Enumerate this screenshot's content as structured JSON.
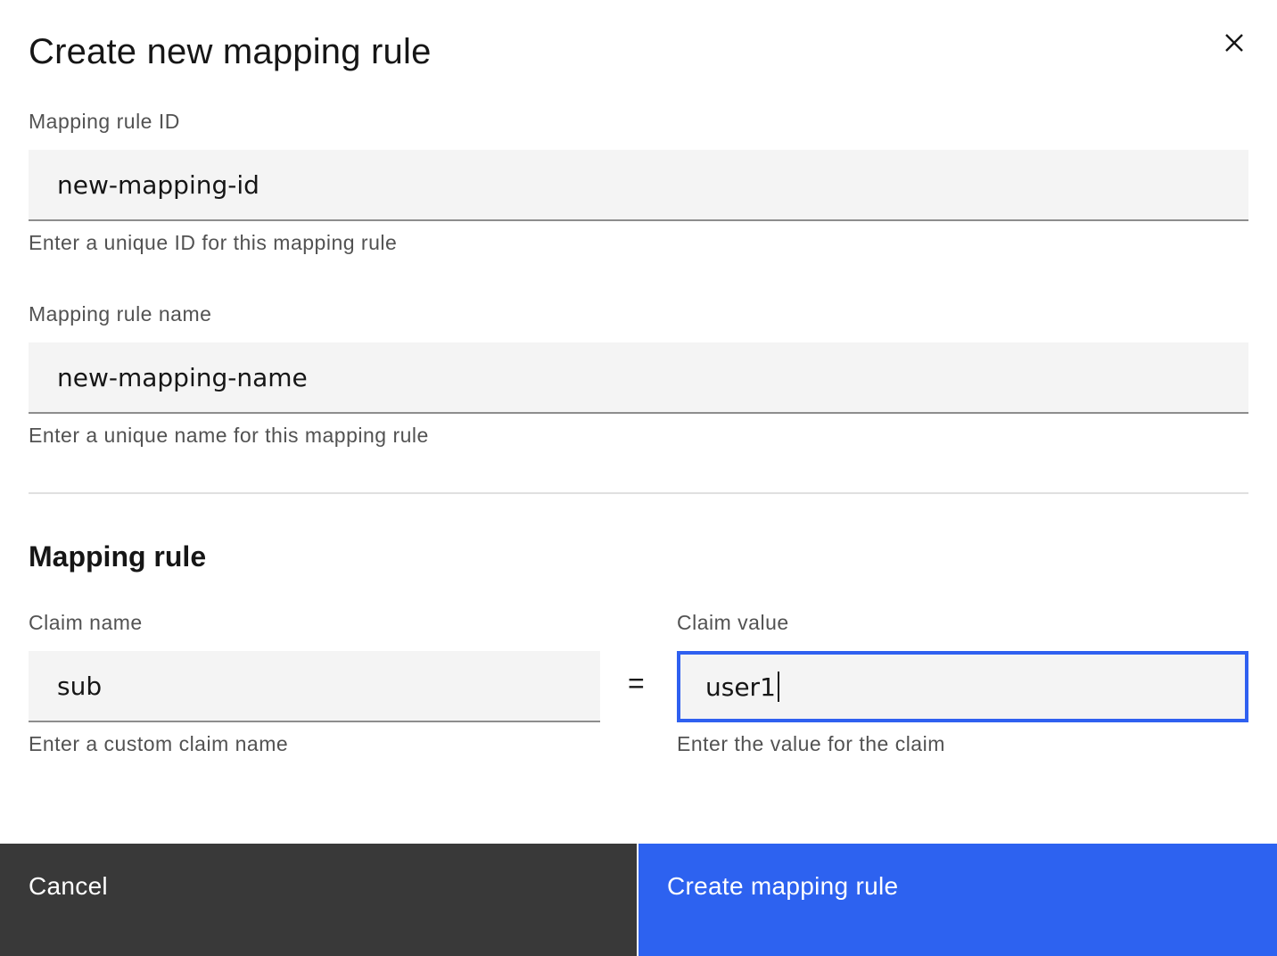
{
  "modal": {
    "title": "Create new mapping rule",
    "close_icon": "close-icon"
  },
  "mapping_id": {
    "label": "Mapping rule ID",
    "value": "new-mapping-id",
    "helper": "Enter a unique ID for this mapping rule"
  },
  "mapping_name": {
    "label": "Mapping rule name",
    "value": "new-mapping-name",
    "helper": "Enter a unique name for this mapping rule"
  },
  "rule_section": {
    "heading": "Mapping rule",
    "operator": "="
  },
  "claim_name": {
    "label": "Claim name",
    "value": "sub",
    "helper": "Enter a custom claim name"
  },
  "claim_value": {
    "label": "Claim value",
    "value": "user1",
    "helper": "Enter the value for the claim"
  },
  "footer": {
    "cancel_label": "Cancel",
    "submit_label": "Create mapping rule"
  },
  "colors": {
    "primary": "#2d62f0",
    "focus_border": "#2f60f0",
    "secondary": "#393939",
    "field_bg": "#f4f4f4"
  }
}
